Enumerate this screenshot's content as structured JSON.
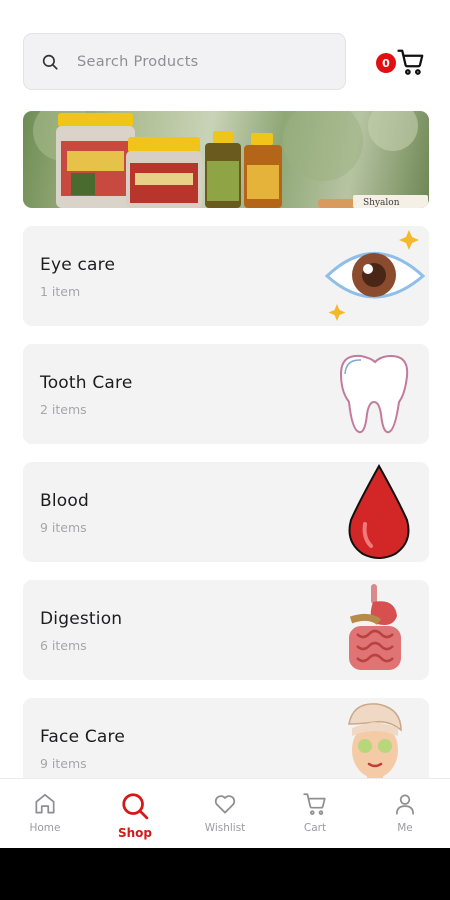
{
  "search": {
    "placeholder": "Search Products"
  },
  "cart": {
    "count": "0"
  },
  "banner": {
    "label": "Shyalon"
  },
  "categories": [
    {
      "name": "Eye care",
      "count": "1 item",
      "icon": "eye-icon"
    },
    {
      "name": "Tooth Care",
      "count": "2 items",
      "icon": "tooth-icon"
    },
    {
      "name": "Blood",
      "count": "9 items",
      "icon": "blood-drop-icon"
    },
    {
      "name": "Digestion",
      "count": "6 items",
      "icon": "digestive-system-icon"
    },
    {
      "name": "Face Care",
      "count": "9 items",
      "icon": "face-mask-icon"
    }
  ],
  "nav": [
    {
      "label": "Home",
      "icon": "home-icon"
    },
    {
      "label": "Shop",
      "icon": "search-icon"
    },
    {
      "label": "Wishlist",
      "icon": "heart-icon"
    },
    {
      "label": "Cart",
      "icon": "cart-icon"
    },
    {
      "label": "Me",
      "icon": "user-icon"
    }
  ],
  "colors": {
    "accent": "#d41919",
    "badge": "#e01010",
    "card": "#f3f3f4"
  }
}
